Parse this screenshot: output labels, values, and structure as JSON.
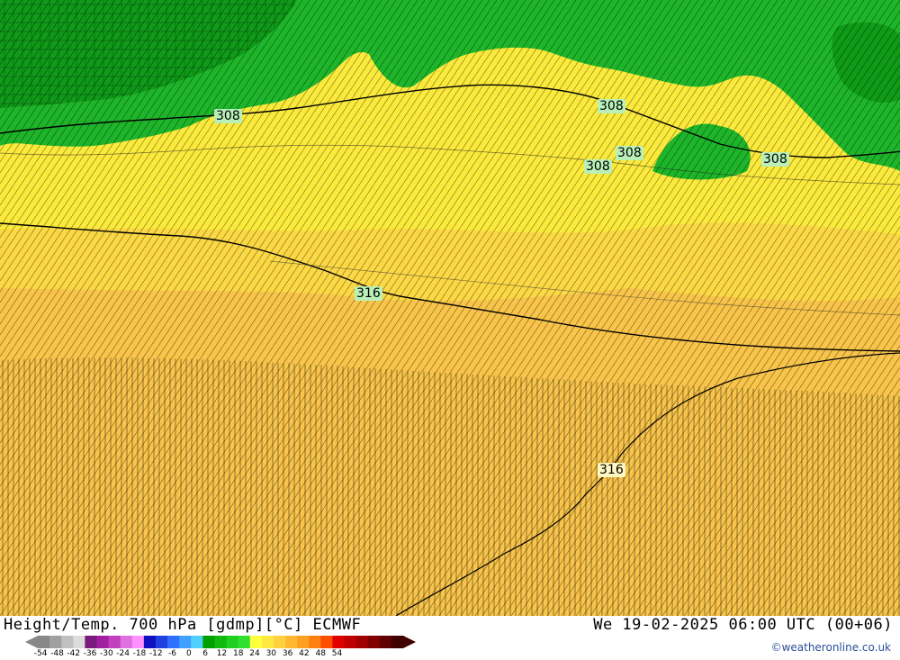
{
  "map": {
    "contour_labels": [
      {
        "text": "308",
        "style": "green"
      },
      {
        "text": "308",
        "style": "green"
      },
      {
        "text": "308",
        "style": "green"
      },
      {
        "text": "308",
        "style": "green"
      },
      {
        "text": "308",
        "style": "green"
      },
      {
        "text": "316",
        "style": "green"
      },
      {
        "text": "316",
        "style": "pale"
      }
    ],
    "colors": {
      "green_dark": "#0f9a18",
      "green_light": "#22c32b",
      "yellow": "#fbeb3c",
      "yellow_orange": "#fbd640",
      "orange": "#f8bf45",
      "contour_line": "#000000"
    }
  },
  "footer": {
    "title": "Height/Temp. 700 hPa [gdmp][°C] ECMWF",
    "datetime": "We 19-02-2025 06:00 UTC (00+06)",
    "credit": "©weatheronline.co.uk",
    "scale_ticks": [
      "-54",
      "-48",
      "-42",
      "-36",
      "-30",
      "-24",
      "-18",
      "-12",
      "-6",
      "0",
      "6",
      "12",
      "18",
      "24",
      "30",
      "36",
      "42",
      "48",
      "54"
    ],
    "scale_colors": [
      "#888888",
      "#a0a0a0",
      "#c0c0c0",
      "#dcdcdc",
      "#7a1a7a",
      "#a020a0",
      "#c040c0",
      "#e070e0",
      "#ff90ff",
      "#1010c0",
      "#2040e0",
      "#3070ff",
      "#40a0ff",
      "#50d0ff",
      "#00a000",
      "#10b810",
      "#20d020",
      "#30e030",
      "#ffff40",
      "#ffe840",
      "#ffd040",
      "#ffb830",
      "#ffa020",
      "#ff8010",
      "#ff5000",
      "#e00000",
      "#c00000",
      "#a00000",
      "#800000",
      "#600000",
      "#400000"
    ]
  }
}
